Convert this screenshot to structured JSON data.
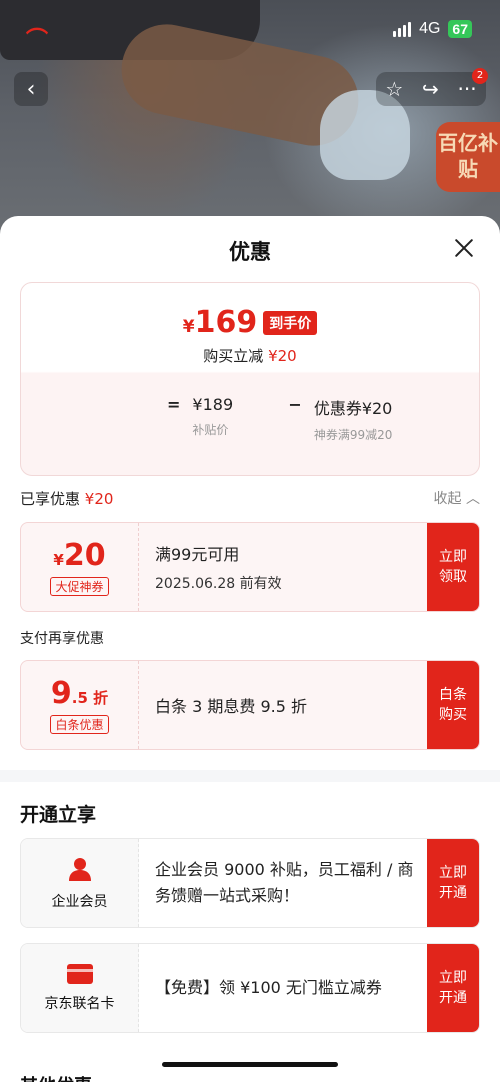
{
  "status": {
    "network": "4G",
    "battery": "67"
  },
  "hero": {
    "subsidy_tag": "百亿补贴",
    "nav_badge": "2"
  },
  "sheet": {
    "title": "优惠",
    "final": {
      "currency": "¥",
      "price": "169",
      "tag": "到手价"
    },
    "discount_line": {
      "label": "购买立减",
      "amount": "¥20"
    },
    "formula": {
      "eq": "=",
      "base": "¥189",
      "base_label": "补贴价",
      "minus": "−",
      "coupon": "优惠券¥20",
      "coupon_label": "神券满99减20"
    },
    "enjoyed": {
      "label": "已享优惠",
      "amount": "¥20",
      "collapse": "收起"
    },
    "coupon1": {
      "currency": "¥",
      "value": "20",
      "badge": "大促神券",
      "condition": "满99元可用",
      "expiry": "2025.06.28 前有效",
      "action": "立即领取"
    },
    "pay_label": "支付再享优惠",
    "coupon2": {
      "value": "9",
      "suffix": ".5 折",
      "badge": "白条优惠",
      "desc": "白条 3 期息费 9.5 折",
      "action": "白条购买"
    },
    "open_title": "开通立享",
    "service1": {
      "name": "企业会员",
      "desc": "企业会员 9000 补贴，员工福利 / 商务馈赠一站式采购！",
      "action": "立即开通"
    },
    "service2": {
      "name": "京东联名卡",
      "desc": "【免费】领 ¥100 无门槛立减券",
      "action": "立即开通"
    },
    "bottom_peek": "其他优惠"
  },
  "colors": {
    "accent": "#e1251b",
    "coupon_bg": "#fdf5f5",
    "success": "#35c759"
  }
}
